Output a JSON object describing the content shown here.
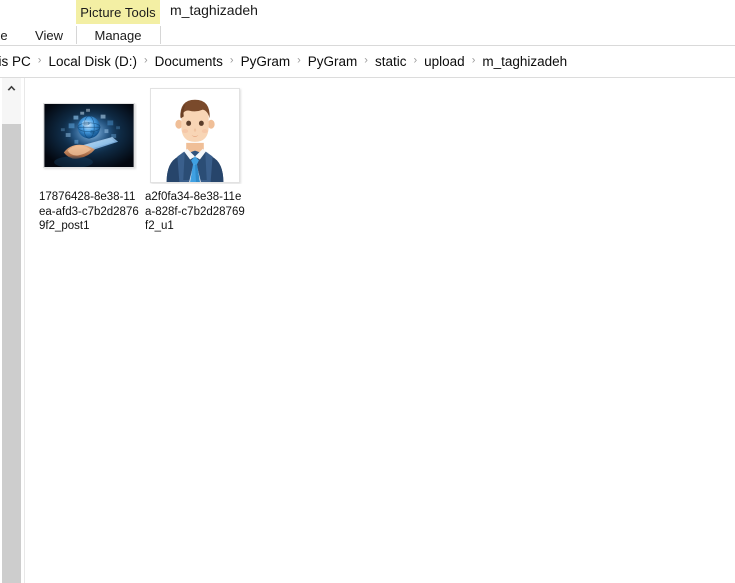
{
  "window": {
    "title": "m_taghizadeh"
  },
  "ribbon": {
    "contextual_group_label": "Picture Tools",
    "contextual_group_color": "#f3efa4",
    "tabs": [
      {
        "label": "e",
        "name": "tab-truncated",
        "active": false
      },
      {
        "label": "View",
        "name": "tab-view",
        "active": false
      },
      {
        "label": "Manage",
        "name": "tab-manage",
        "active": true
      }
    ]
  },
  "address_bar": {
    "separator": "›",
    "breadcrumb": [
      {
        "label": "his PC"
      },
      {
        "label": "Local Disk (D:)"
      },
      {
        "label": "Documents"
      },
      {
        "label": "PyGram"
      },
      {
        "label": "PyGram"
      },
      {
        "label": "static"
      },
      {
        "label": "upload"
      },
      {
        "label": "m_taghizadeh"
      }
    ]
  },
  "content": {
    "scrollbar": {
      "up_arrow_icon": "chevron-up-icon"
    },
    "items": [
      {
        "name": "17876428-8e38-11ea-afd3-c7b2d28769f2_post1",
        "thumbnail_type": "photo-dark-tech-globe",
        "orientation": "landscape"
      },
      {
        "name": "a2f0fa34-8e38-11ea-828f-c7b2d28769f2_u1",
        "thumbnail_type": "avatar-man-in-suit",
        "orientation": "square"
      }
    ]
  }
}
